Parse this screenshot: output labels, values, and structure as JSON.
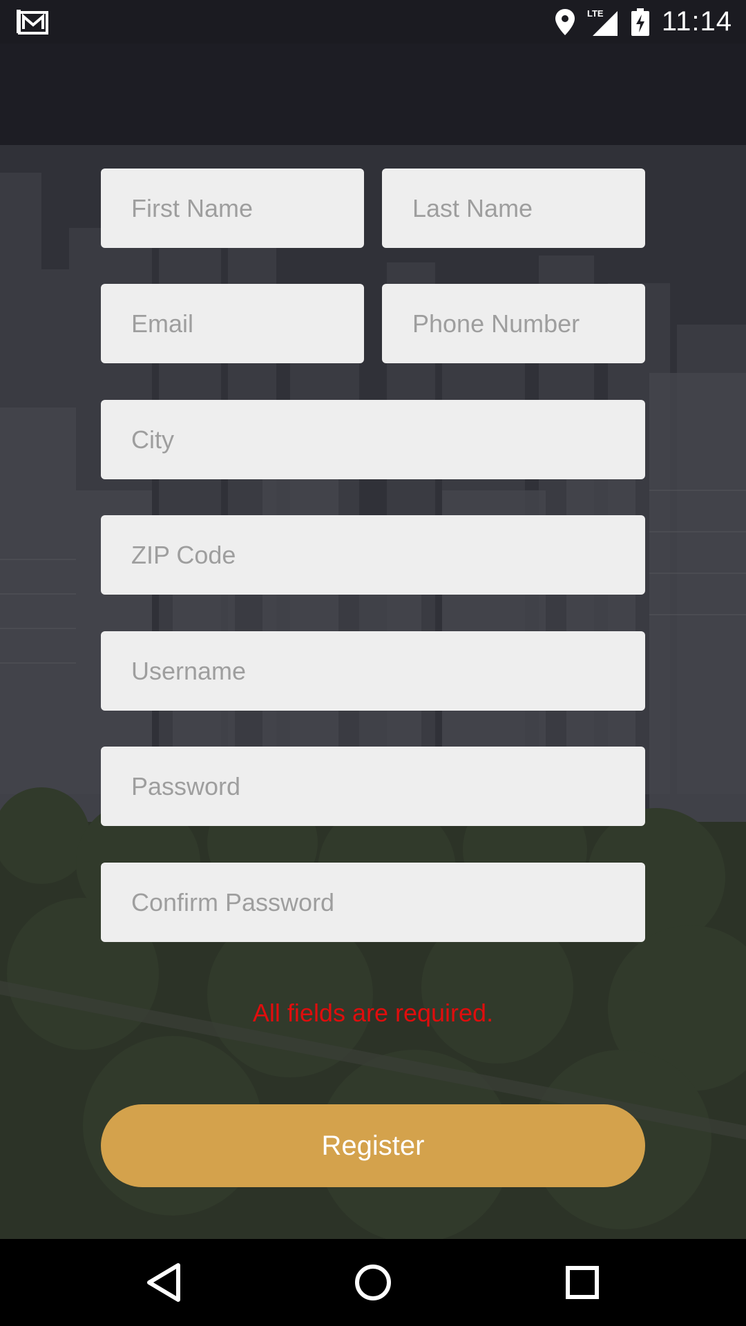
{
  "status_bar": {
    "time": "11:14",
    "network": "LTE",
    "icons": [
      "gmail-icon",
      "location-icon",
      "signal-icon",
      "battery-charging-icon"
    ]
  },
  "form": {
    "first_name": {
      "placeholder": "First Name",
      "value": ""
    },
    "last_name": {
      "placeholder": "Last Name",
      "value": ""
    },
    "email": {
      "placeholder": "Email",
      "value": ""
    },
    "phone": {
      "placeholder": "Phone Number",
      "value": ""
    },
    "city": {
      "placeholder": "City",
      "value": ""
    },
    "zip": {
      "placeholder": "ZIP Code",
      "value": ""
    },
    "username": {
      "placeholder": "Username",
      "value": ""
    },
    "password": {
      "placeholder": "Password",
      "value": ""
    },
    "confirm_password": {
      "placeholder": "Confirm Password",
      "value": ""
    },
    "error_message": "All fields are required.",
    "register_label": "Register"
  },
  "nav_bar": {
    "icons": [
      "back-icon",
      "home-icon",
      "recents-icon"
    ]
  },
  "colors": {
    "accent": "#d4a24c",
    "error": "#e00d0d",
    "field_bg": "#eeeeee"
  }
}
